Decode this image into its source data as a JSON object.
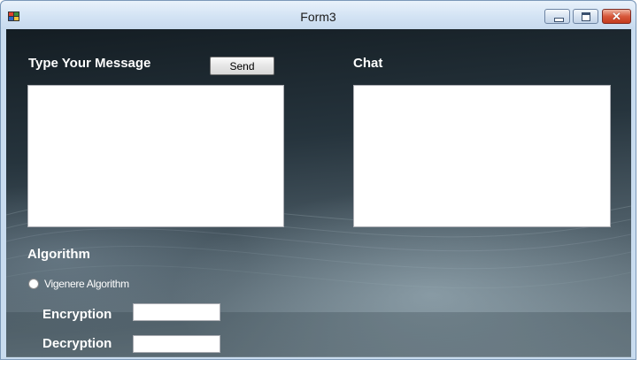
{
  "window": {
    "title": "Form3",
    "icon": "windows-form-icon",
    "controls": {
      "minimize": "minimize-icon",
      "maximize": "maximize-icon",
      "close": "close-icon",
      "close_glyph": "✕"
    }
  },
  "message": {
    "label": "Type Your Message",
    "send_label": "Send",
    "value": ""
  },
  "chat": {
    "label": "Chat",
    "value": ""
  },
  "algorithm": {
    "label": "Algorithm",
    "options": [
      {
        "label": "Vigenere Algorithm",
        "selected": false
      }
    ]
  },
  "encryption": {
    "label": "Encryption",
    "value": ""
  },
  "decryption": {
    "label": "Decryption",
    "value": ""
  }
}
